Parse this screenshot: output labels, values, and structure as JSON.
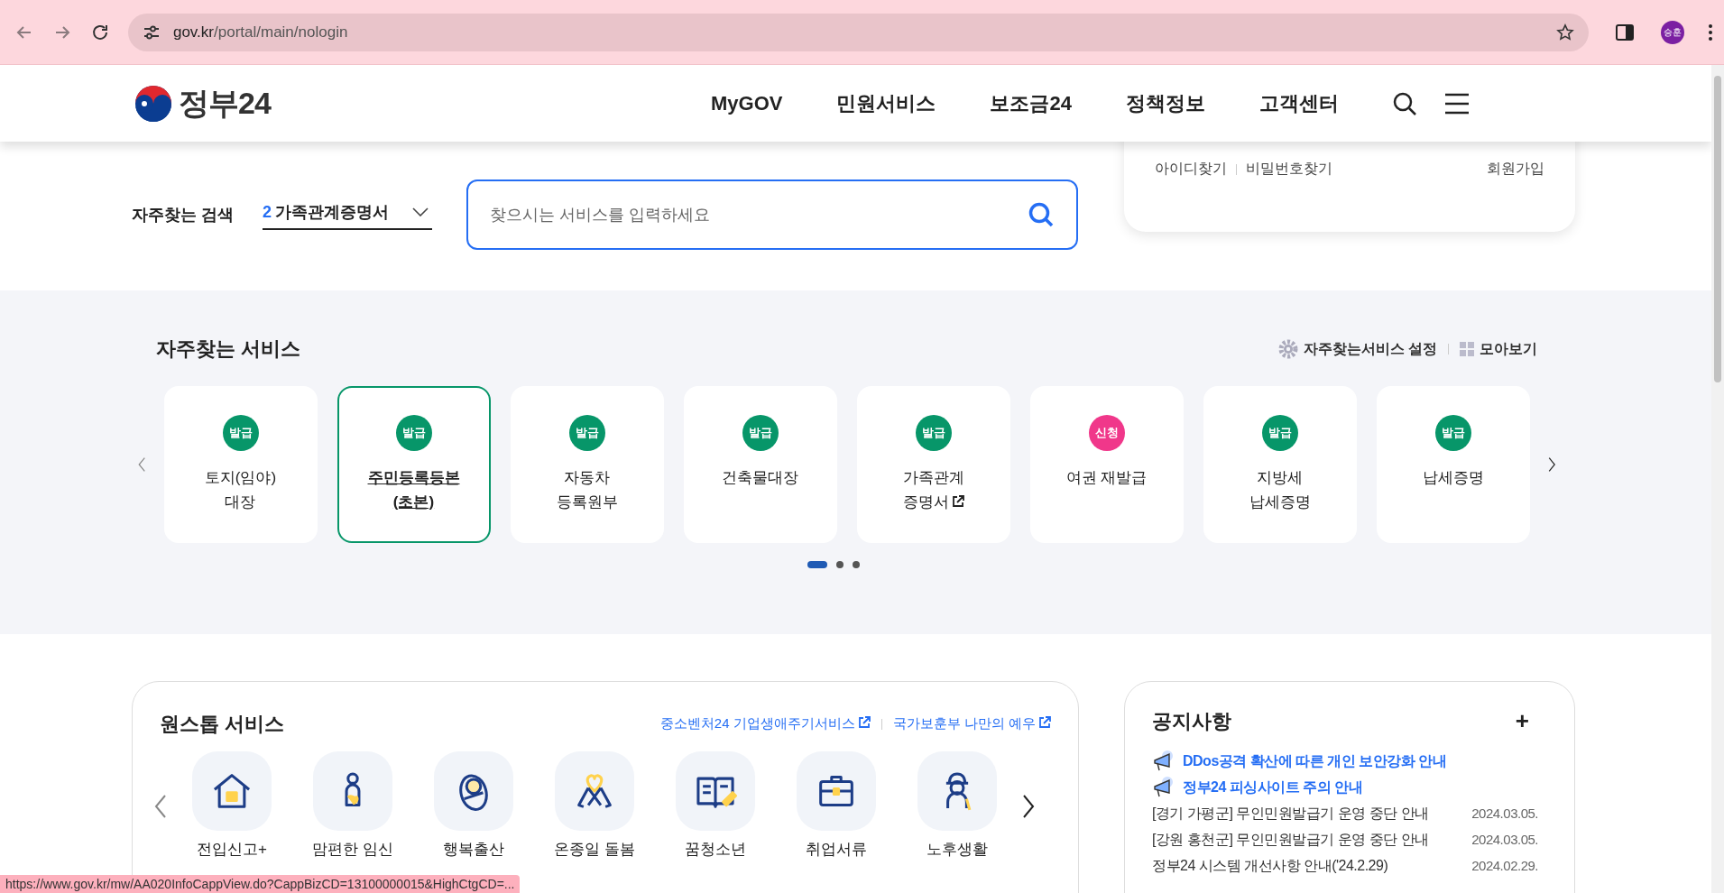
{
  "browser": {
    "url_host": "gov.kr",
    "url_path": "/portal/main/nologin",
    "profile": "승훈",
    "status_url": "https://www.gov.kr/mw/AA020InfoCappView.do?CappBizCD=13100000015&HighCtgCD=..."
  },
  "header": {
    "logo_text": "정부24",
    "nav": [
      "MyGOV",
      "민원서비스",
      "보조금24",
      "정책정보",
      "고객센터"
    ]
  },
  "search": {
    "label": "자주찾는 검색",
    "select_number": "2",
    "select_value": "가족관계증명서",
    "placeholder": "찾으시는 서비스를 입력하세요"
  },
  "account": {
    "links": [
      "아이디찾기",
      "비밀번호찾기"
    ],
    "signup": "회원가입"
  },
  "frequent": {
    "title": "자주찾는 서비스",
    "settings": "자주찾는서비스 설정",
    "view_all": "모아보기",
    "services": [
      {
        "badge": "발급",
        "kind": "issue",
        "lines": [
          "토지(임야)",
          "대장"
        ],
        "selected": false,
        "external": false
      },
      {
        "badge": "발급",
        "kind": "issue",
        "lines": [
          "주민등록등본",
          "(초본)"
        ],
        "selected": true,
        "external": false
      },
      {
        "badge": "발급",
        "kind": "issue",
        "lines": [
          "자동차",
          "등록원부"
        ],
        "selected": false,
        "external": false
      },
      {
        "badge": "발급",
        "kind": "issue",
        "lines": [
          "건축물대장"
        ],
        "selected": false,
        "external": false
      },
      {
        "badge": "발급",
        "kind": "issue",
        "lines": [
          "가족관계",
          "증명서"
        ],
        "selected": false,
        "external": true
      },
      {
        "badge": "신청",
        "kind": "apply",
        "lines": [
          "여권 재발급"
        ],
        "selected": false,
        "external": false
      },
      {
        "badge": "발급",
        "kind": "issue",
        "lines": [
          "지방세",
          "납세증명"
        ],
        "selected": false,
        "external": false
      },
      {
        "badge": "발급",
        "kind": "issue",
        "lines": [
          "납세증명"
        ],
        "selected": false,
        "external": false
      }
    ],
    "pages": [
      {
        "selected": true
      },
      {
        "selected": false
      },
      {
        "selected": false
      }
    ]
  },
  "onestop": {
    "title": "원스톱 서비스",
    "links": [
      "중소벤처24 기업생애주기서비스",
      "국가보훈부 나만의 예우"
    ],
    "items": [
      "전입신고+",
      "맘편한 임신",
      "행복출산",
      "온종일 돌봄",
      "꿈청소년",
      "취업서류",
      "노후생활"
    ]
  },
  "notices": {
    "title": "공지사항",
    "more": "+",
    "featured": [
      "DDos공격 확산에 따른 개인 보안강화 안내",
      "정부24 피싱사이트 주의 안내"
    ],
    "items": [
      {
        "title": "[경기 가평군] 무인민원발급기 운영 중단 안내",
        "date": "2024.03.05."
      },
      {
        "title": "[강원 홍천군] 무인민원발급기 운영 중단 안내",
        "date": "2024.03.05."
      },
      {
        "title": "정부24 시스템 개선사항 안내('24.2.29)",
        "date": "2024.02.29."
      }
    ]
  }
}
